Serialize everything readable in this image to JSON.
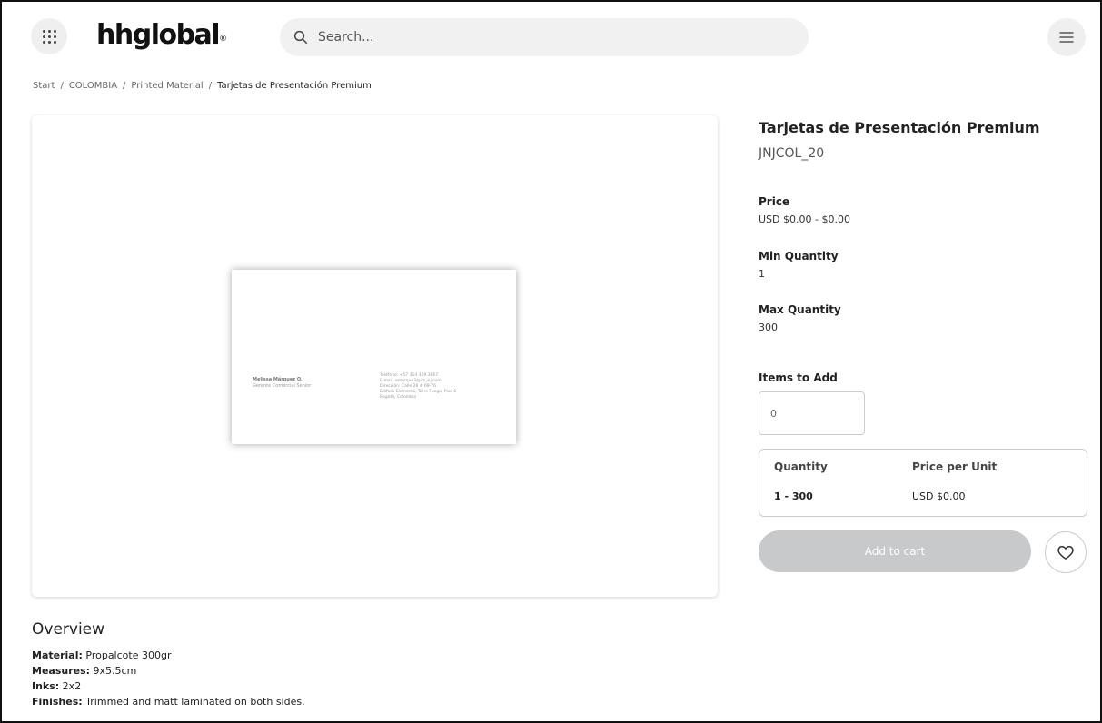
{
  "header": {
    "logo": "hhglobal",
    "logo_mark": "®",
    "search_placeholder": "Search..."
  },
  "breadcrumb": {
    "items": [
      "Start",
      "COLOMBIA",
      "Printed Material",
      "Tarjetas de Presentación Premium"
    ],
    "separator": "/"
  },
  "card_preview": {
    "name": "Melissa Márquez O.",
    "role": "Gerente Comercial Senior",
    "contact": [
      "Teléfono: +57 314 359 3667",
      "E-mail: emarque3@its.jnj.com",
      "Dirección: Calle 26 # 69-76",
      "Edificio Elemento, Torre Fuego, Piso 6",
      "Bogotá, Colombia"
    ]
  },
  "product": {
    "title": "Tarjetas de Presentación Premium",
    "sku": "JNJCOL_20",
    "price_label": "Price",
    "price_value": "USD $0.00 - $0.00",
    "min_label": "Min Quantity",
    "min_value": "1",
    "max_label": "Max Quantity",
    "max_value": "300",
    "items_label": "Items to Add",
    "items_value": "0",
    "tier_headers": [
      "Quantity",
      "Price per Unit"
    ],
    "tier_rows": [
      {
        "quantity": "1 - 300",
        "price": "USD $0.00"
      }
    ],
    "add_to_cart": "Add to cart"
  },
  "overview": {
    "title": "Overview",
    "specs": [
      {
        "label": "Material:",
        "value": " Propalcote 300gr"
      },
      {
        "label": "Measures:",
        "value": " 9x5.5cm"
      },
      {
        "label": "Inks:",
        "value": " 2x2"
      },
      {
        "label": "Finishes:",
        "value": " Trimmed and matt laminated on both sides."
      }
    ]
  },
  "colors": {
    "button_disabled": "#c8c9cb",
    "header_button_bg": "#efefef",
    "search_bg": "#f1f1f1"
  }
}
